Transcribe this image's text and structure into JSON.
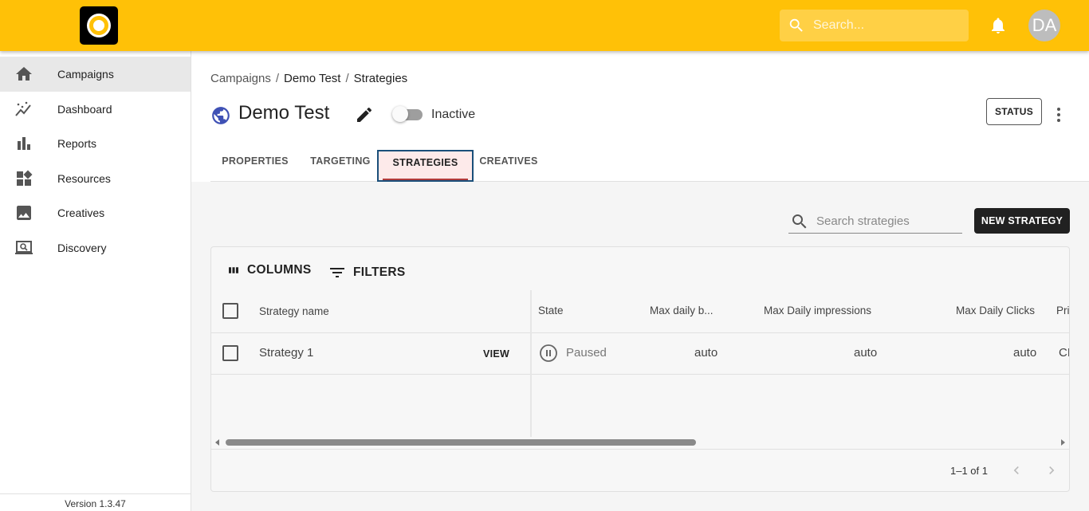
{
  "topbar": {
    "search_placeholder": "Search...",
    "avatar_initials": "DA",
    "accent_color": "#ffc107"
  },
  "sidebar": {
    "items": [
      {
        "label": "Campaigns",
        "icon": "home-icon",
        "active": true
      },
      {
        "label": "Dashboard",
        "icon": "trend-icon"
      },
      {
        "label": "Reports",
        "icon": "bar-chart-icon"
      },
      {
        "label": "Resources",
        "icon": "widgets-icon"
      },
      {
        "label": "Creatives",
        "icon": "image-icon"
      },
      {
        "label": "Discovery",
        "icon": "laptop-search-icon"
      }
    ],
    "version": "Version 1.3.47"
  },
  "breadcrumb": {
    "items": [
      "Campaigns",
      "Demo Test",
      "Strategies"
    ],
    "separator": "/"
  },
  "campaign": {
    "title": "Demo Test",
    "toggle_label": "Inactive",
    "status_button": "STATUS"
  },
  "tabs": [
    {
      "label": "PROPERTIES"
    },
    {
      "label": "TARGETING"
    },
    {
      "label": "STRATEGIES",
      "active": true
    },
    {
      "label": "CREATIVES"
    }
  ],
  "strategies": {
    "search_placeholder": "Search strategies",
    "new_button": "NEW STRATEGY",
    "toolbar": {
      "columns": "COLUMNS",
      "filters": "FILTERS"
    },
    "columns": [
      "Strategy name",
      "State",
      "Max daily b...",
      "Max Daily impressions",
      "Max Daily Clicks",
      "Pri"
    ],
    "rows": [
      {
        "name": "Strategy 1",
        "view": "VIEW",
        "state": "Paused",
        "max_daily_budget": "auto",
        "max_daily_impressions": "auto",
        "max_daily_clicks": "auto",
        "pri": "CP"
      }
    ],
    "pagination": "1–1 of 1"
  }
}
